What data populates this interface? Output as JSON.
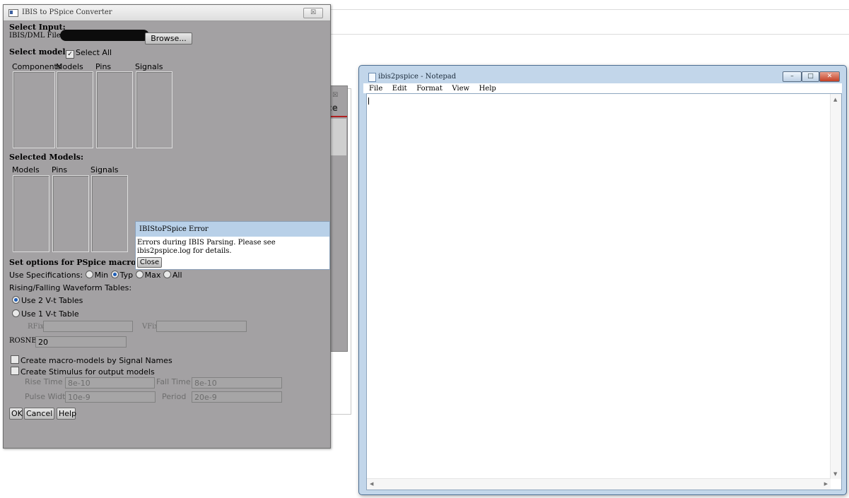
{
  "ibis_window": {
    "title": "IBIS to PSpice Converter",
    "close_glyph": "☒",
    "select_input_header": "Select Input:",
    "file_label": "IBIS/DML File",
    "browse_label": "Browse...",
    "select_models_header": "Select models:",
    "select_all_label": "Select All",
    "model_columns": [
      "Components",
      "Models",
      "Pins",
      "Signals"
    ],
    "selected_models_header": "Selected Models:",
    "selected_columns": [
      "Models",
      "Pins",
      "Signals"
    ],
    "options_header": "Set options for PSpice macro-mo",
    "use_spec_label": "Use Specifications:",
    "spec_options": [
      "Min",
      "Typ",
      "Max",
      "All"
    ],
    "spec_selected": "Typ",
    "waveform_tables_label": "Rising/Falling Waveform Tables:",
    "use_2_label": "Use 2 V-t Tables",
    "use_1_label": "Use 1 V-t Table",
    "rfix_label": "RFix",
    "vfix_label": "VFix",
    "rosnb_label": "ROSNB",
    "rosnb_value": "20",
    "create_by_signal_label": "Create macro-models by Signal Names",
    "create_stimulus_label": "Create Stimulus for output models",
    "rise_time_label": "Rise Time",
    "rise_time_value": "8e-10",
    "fall_time_label": "Fall Time",
    "fall_time_value": "8e-10",
    "pulse_width_label": "Pulse Width",
    "pulse_width_value": "10e-9",
    "period_label": "Period",
    "period_value": "20e-9",
    "ok_label": "OK",
    "cancel_label": "Cancel",
    "help_label": "Help"
  },
  "background_window": {
    "close_glyph": "☒",
    "title_fragment": "ce"
  },
  "error_dialog": {
    "title": "IBIStoPSpice Error",
    "message": "Errors during IBIS Parsing. Please see ibis2pspice.log for details.",
    "close_label": "Close"
  },
  "notepad": {
    "title": "ibis2pspice - Notepad",
    "menu": [
      "File",
      "Edit",
      "Format",
      "View",
      "Help"
    ],
    "minimize_glyph": "–",
    "maximize_glyph": "□",
    "close_glyph": "✕",
    "content": ""
  }
}
